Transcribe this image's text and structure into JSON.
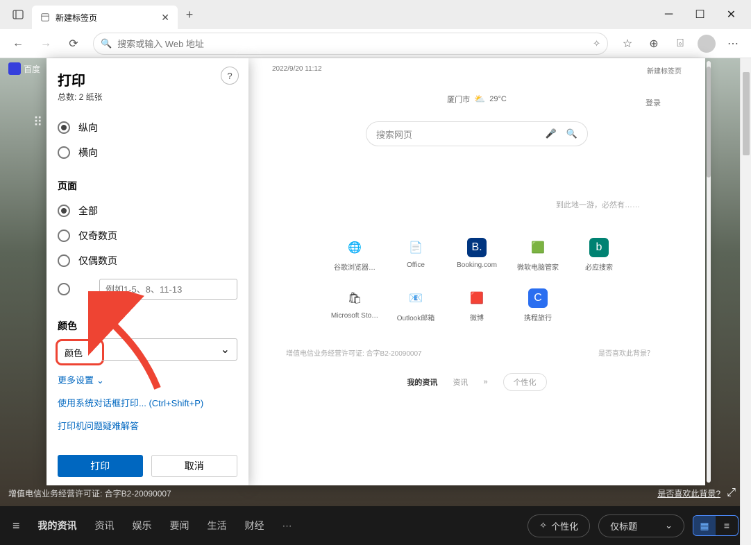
{
  "titlebar": {
    "tab_title": "新建标签页"
  },
  "toolbar": {
    "address_placeholder": "搜索或输入 Web 地址"
  },
  "page_underneath": {
    "link_text": "百度",
    "license": "增值电信业务经营许可证: 合字B2-20090007",
    "bg_question": "是否喜欢此背景?"
  },
  "bottom_bar": {
    "items": [
      "我的资讯",
      "资讯",
      "娱乐",
      "要闻",
      "生活",
      "财经"
    ],
    "personalize": "个性化",
    "filter": "仅标题"
  },
  "print": {
    "title": "打印",
    "total": "总数: 2 纸张",
    "orientation_label_portrait": "纵向",
    "orientation_label_landscape": "横向",
    "pages_section": "页面",
    "pages_all": "全部",
    "pages_odd": "仅奇数页",
    "pages_even": "仅偶数页",
    "pages_range_placeholder": "例如1-5、8、11-13",
    "color_section": "颜色",
    "color_value": "颜色",
    "more_settings": "更多设置",
    "system_dialog": "使用系统对话框打印... (Ctrl+Shift+P)",
    "troubleshoot": "打印机问题疑难解答",
    "btn_print": "打印",
    "btn_cancel": "取消"
  },
  "preview": {
    "timestamp": "2022/9/20 11:12",
    "page_title": "新建标签页",
    "location": "厦门市",
    "temp": "29°C",
    "login": "登录",
    "search_placeholder": "搜索网页",
    "drift_text": "到此地一游，必然有……",
    "tiles": [
      {
        "label": "谷歌浏览器…",
        "bg": "#fff",
        "txt": "🌐"
      },
      {
        "label": "Office",
        "bg": "#fff",
        "txt": "📄"
      },
      {
        "label": "Booking.com",
        "bg": "#003580",
        "txt": "B."
      },
      {
        "label": "微软电脑管家",
        "bg": "#fff",
        "txt": "🟩"
      },
      {
        "label": "必应搜索",
        "bg": "#008272",
        "txt": "b"
      },
      {
        "label": "Microsoft Sto…",
        "bg": "#fff",
        "txt": "🛍"
      },
      {
        "label": "Outlook邮箱",
        "bg": "#fff",
        "txt": "📧"
      },
      {
        "label": "微博",
        "bg": "#fff",
        "txt": "🟥"
      },
      {
        "label": "携程旅行",
        "bg": "#2a6ef0",
        "txt": "C"
      }
    ],
    "license": "增值电信业务经营许可证: 合字B2-20090007",
    "bg_question": "是否喜欢此背景？",
    "bottom_tabs": {
      "my": "我的资讯",
      "news": "资讯",
      "more": "»",
      "personalize": "个性化"
    }
  }
}
